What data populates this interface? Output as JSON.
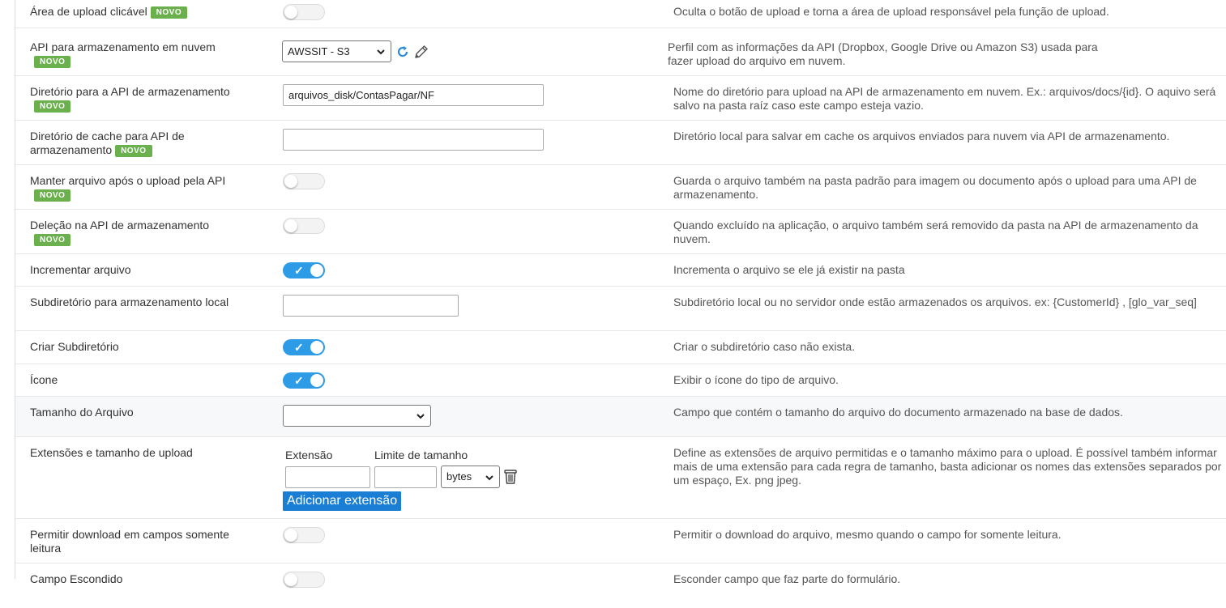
{
  "badge": "NOVO",
  "rows": [
    {
      "label": "Área de upload clicável",
      "desc": "Oculta o botão de upload e torna a área de upload responsável pela função de upload.",
      "toggle": "off"
    },
    {
      "label": "API para armazenamento em nuvem",
      "desc_lines": [
        "Perfil com as informações da API (Dropbox, Google Drive ou Amazon S3) usada para",
        "fazer upload do arquivo em nuvem."
      ],
      "select_value": "AWSSIT - S3"
    },
    {
      "label": "Diretório para a API de armazenamento",
      "desc": "Nome do diretório para upload na API de armazenamento em nuvem. Ex.: arquivos/docs/{id}. O aquivo será salvo na pasta raíz caso este campo esteja vazio.",
      "input_value": "arquivos_disk/ContasPagar/NF"
    },
    {
      "label": "Diretório de cache para API de armazenamento",
      "desc": "Diretório local para salvar em cache os arquivos enviados para nuvem via API de armazenamento.",
      "input_value": ""
    },
    {
      "label": "Manter arquivo após o upload pela API",
      "desc": "Guarda o arquivo também na pasta padrão para imagem ou documento após o upload para uma API de armazenamento.",
      "toggle": "off"
    },
    {
      "label": "Deleção na API de armazenamento",
      "desc": "Quando excluído na aplicação, o arquivo também será removido da pasta na API de armazenamento da nuvem.",
      "toggle": "off"
    },
    {
      "label": "Incrementar arquivo",
      "desc": "Incrementa o arquivo se ele já existir na pasta",
      "toggle": "on"
    },
    {
      "label": "Subdiretório para armazenamento local",
      "desc": "Subdiretório local ou no servidor onde estão armazenados os arquivos. ex: {CustomerId} , [glo_var_seq]",
      "input_value": ""
    },
    {
      "label": "Criar Subdiretório",
      "desc": "Criar o subdiretório caso não exista.",
      "toggle": "on"
    },
    {
      "label": "Ícone",
      "desc": "Exibir o ícone do tipo de arquivo.",
      "toggle": "on"
    },
    {
      "label": "Tamanho do Arquivo",
      "desc": "Campo que contém o tamanho do arquivo do documento armazenado na base de dados.",
      "select_value": ""
    },
    {
      "label": "Extensões e tamanho de upload",
      "desc": "Define as extensões de arquivo permitidas e o tamanho máximo para o upload. É possível também informar mais de uma extensão para cada regra de tamanho, basta adicionar os nomes das extensões separados por um espaço, Ex. png jpeg.",
      "extension_label": "Extensão",
      "size_limit_label": "Limite de tamanho",
      "unit_value": "bytes",
      "add_button": "Adicionar extensão"
    },
    {
      "label": "Permitir download em campos somente leitura",
      "desc": "Permitir o download do arquivo, mesmo quando o campo for somente leitura.",
      "toggle": "off"
    },
    {
      "label": "Campo Escondido",
      "desc": "Esconder campo que faz parte do formulário.",
      "toggle": "off"
    }
  ],
  "colors": {
    "accent": "#2d9be6",
    "badge": "#6ab04c",
    "button": "#1a7fd4"
  }
}
